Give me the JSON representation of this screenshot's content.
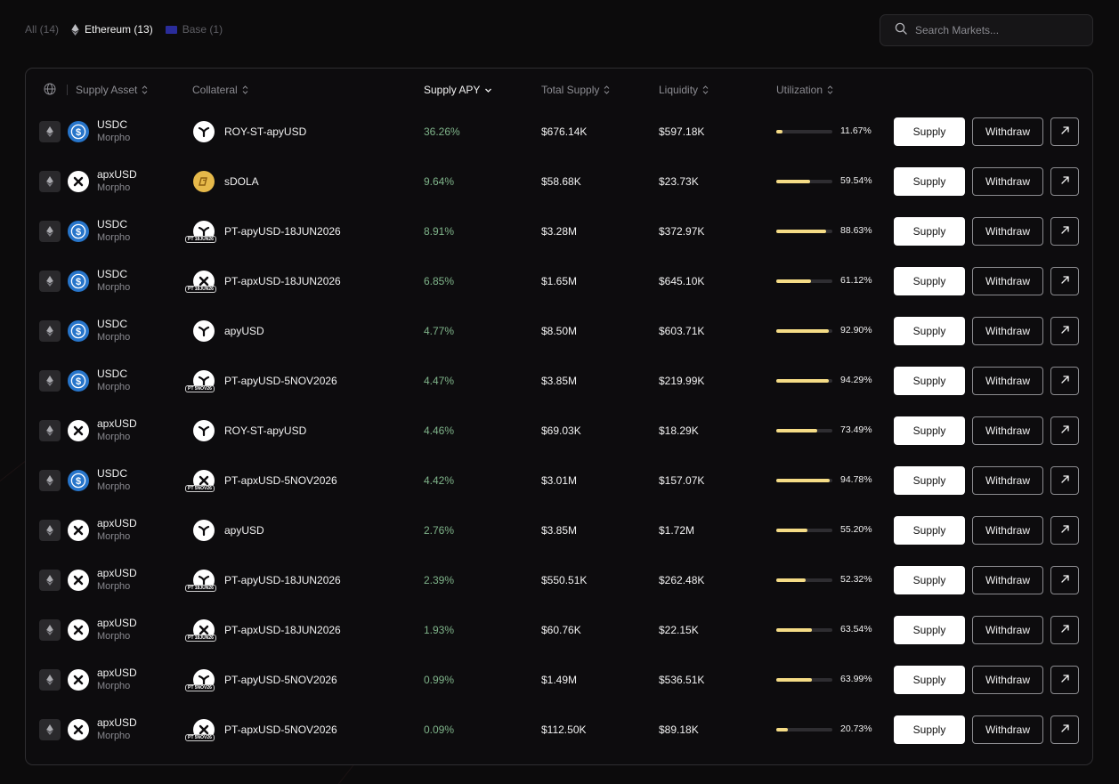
{
  "filters": {
    "all": "All (14)",
    "ethereum": "Ethereum (13)",
    "base": "Base (1)"
  },
  "search": {
    "placeholder": "Search Markets..."
  },
  "table": {
    "headers": {
      "supply_asset": "Supply Asset",
      "collateral": "Collateral",
      "supply_apy": "Supply APY",
      "total_supply": "Total Supply",
      "liquidity": "Liquidity",
      "utilization": "Utilization"
    },
    "buttons": {
      "supply": "Supply",
      "withdraw": "Withdraw"
    },
    "rows": [
      {
        "asset": "USDC",
        "asset_icon": "usdc-icon",
        "protocol": "Morpho",
        "collateral": "ROY-ST-apyUSD",
        "collateral_icon": "apyusd-icon",
        "pt_badge": "",
        "apy": "36.26%",
        "total_supply": "$676.14K",
        "liquidity": "$597.18K",
        "utilization": "11.67%",
        "utilization_value": 11.67
      },
      {
        "asset": "apxUSD",
        "asset_icon": "apxusd-icon",
        "protocol": "Morpho",
        "collateral": "sDOLA",
        "collateral_icon": "sdola-icon",
        "pt_badge": "",
        "apy": "9.64%",
        "total_supply": "$58.68K",
        "liquidity": "$23.73K",
        "utilization": "59.54%",
        "utilization_value": 59.54
      },
      {
        "asset": "USDC",
        "asset_icon": "usdc-icon",
        "protocol": "Morpho",
        "collateral": "PT-apyUSD-18JUN2026",
        "collateral_icon": "apyusd-icon",
        "pt_badge": "PT 18JUN26",
        "apy": "8.91%",
        "total_supply": "$3.28M",
        "liquidity": "$372.97K",
        "utilization": "88.63%",
        "utilization_value": 88.63
      },
      {
        "asset": "USDC",
        "asset_icon": "usdc-icon",
        "protocol": "Morpho",
        "collateral": "PT-apxUSD-18JUN2026",
        "collateral_icon": "apxusd-icon",
        "pt_badge": "PT 18JUN26",
        "apy": "6.85%",
        "total_supply": "$1.65M",
        "liquidity": "$645.10K",
        "utilization": "61.12%",
        "utilization_value": 61.12
      },
      {
        "asset": "USDC",
        "asset_icon": "usdc-icon",
        "protocol": "Morpho",
        "collateral": "apyUSD",
        "collateral_icon": "apyusd-icon",
        "pt_badge": "",
        "apy": "4.77%",
        "total_supply": "$8.50M",
        "liquidity": "$603.71K",
        "utilization": "92.90%",
        "utilization_value": 92.9
      },
      {
        "asset": "USDC",
        "asset_icon": "usdc-icon",
        "protocol": "Morpho",
        "collateral": "PT-apyUSD-5NOV2026",
        "collateral_icon": "apyusd-icon",
        "pt_badge": "PT 5NOV26",
        "apy": "4.47%",
        "total_supply": "$3.85M",
        "liquidity": "$219.99K",
        "utilization": "94.29%",
        "utilization_value": 94.29
      },
      {
        "asset": "apxUSD",
        "asset_icon": "apxusd-icon",
        "protocol": "Morpho",
        "collateral": "ROY-ST-apyUSD",
        "collateral_icon": "apyusd-icon",
        "pt_badge": "",
        "apy": "4.46%",
        "total_supply": "$69.03K",
        "liquidity": "$18.29K",
        "utilization": "73.49%",
        "utilization_value": 73.49
      },
      {
        "asset": "USDC",
        "asset_icon": "usdc-icon",
        "protocol": "Morpho",
        "collateral": "PT-apxUSD-5NOV2026",
        "collateral_icon": "apxusd-icon",
        "pt_badge": "PT 5NOV26",
        "apy": "4.42%",
        "total_supply": "$3.01M",
        "liquidity": "$157.07K",
        "utilization": "94.78%",
        "utilization_value": 94.78
      },
      {
        "asset": "apxUSD",
        "asset_icon": "apxusd-icon",
        "protocol": "Morpho",
        "collateral": "apyUSD",
        "collateral_icon": "apyusd-icon",
        "pt_badge": "",
        "apy": "2.76%",
        "total_supply": "$3.85M",
        "liquidity": "$1.72M",
        "utilization": "55.20%",
        "utilization_value": 55.2
      },
      {
        "asset": "apxUSD",
        "asset_icon": "apxusd-icon",
        "protocol": "Morpho",
        "collateral": "PT-apyUSD-18JUN2026",
        "collateral_icon": "apyusd-icon",
        "pt_badge": "PT 18JUN26",
        "apy": "2.39%",
        "total_supply": "$550.51K",
        "liquidity": "$262.48K",
        "utilization": "52.32%",
        "utilization_value": 52.32
      },
      {
        "asset": "apxUSD",
        "asset_icon": "apxusd-icon",
        "protocol": "Morpho",
        "collateral": "PT-apxUSD-18JUN2026",
        "collateral_icon": "apxusd-icon",
        "pt_badge": "PT 18JUN26",
        "apy": "1.93%",
        "total_supply": "$60.76K",
        "liquidity": "$22.15K",
        "utilization": "63.54%",
        "utilization_value": 63.54
      },
      {
        "asset": "apxUSD",
        "asset_icon": "apxusd-icon",
        "protocol": "Morpho",
        "collateral": "PT-apyUSD-5NOV2026",
        "collateral_icon": "apyusd-icon",
        "pt_badge": "PT 5NOV26",
        "apy": "0.99%",
        "total_supply": "$1.49M",
        "liquidity": "$536.51K",
        "utilization": "63.99%",
        "utilization_value": 63.99
      },
      {
        "asset": "apxUSD",
        "asset_icon": "apxusd-icon",
        "protocol": "Morpho",
        "collateral": "PT-apxUSD-5NOV2026",
        "collateral_icon": "apxusd-icon",
        "pt_badge": "PT 5NOV26",
        "apy": "0.09%",
        "total_supply": "$112.50K",
        "liquidity": "$89.18K",
        "utilization": "20.73%",
        "utilization_value": 20.73
      }
    ]
  },
  "colors": {
    "background": "#0c0b0c",
    "apy_green": "#7fb48a",
    "utilization_fill": "#f5dc86",
    "usdc_blue": "#2775ca",
    "base_blue": "#2a2c9a"
  }
}
